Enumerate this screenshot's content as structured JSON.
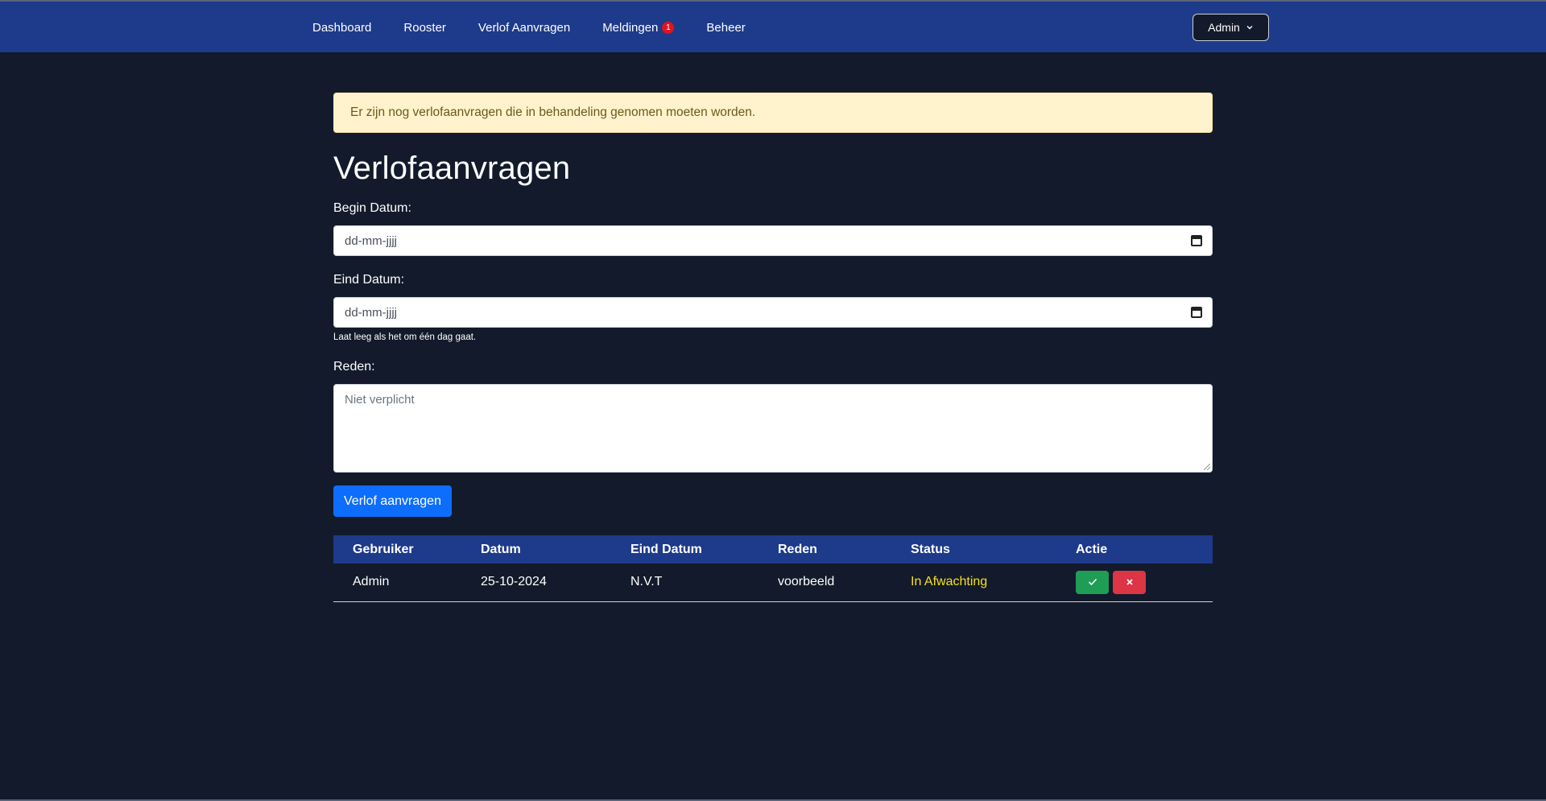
{
  "nav": {
    "links": [
      {
        "label": "Dashboard"
      },
      {
        "label": "Rooster"
      },
      {
        "label": "Verlof Aanvragen"
      },
      {
        "label": "Meldingen",
        "badge": "1"
      },
      {
        "label": "Beheer"
      }
    ],
    "user_menu_label": "Admin"
  },
  "alert": {
    "text": "Er zijn nog verlofaanvragen die in behandeling genomen moeten worden.",
    "color": "#fff3cd"
  },
  "page": {
    "title": "Verlofaanvragen"
  },
  "form": {
    "begin_label": "Begin Datum:",
    "begin_placeholder": "dd-mm-jjjj",
    "end_label": "Eind Datum:",
    "end_placeholder": "dd-mm-jjjj",
    "end_help": "Laat leeg als het om één dag gaat.",
    "reason_label": "Reden:",
    "reason_placeholder": "Niet verplicht",
    "submit_label": "Verlof aanvragen"
  },
  "table": {
    "headers": [
      "Gebruiker",
      "Datum",
      "Eind Datum",
      "Reden",
      "Status",
      "Actie"
    ],
    "rows": [
      {
        "user": "Admin",
        "date": "25-10-2024",
        "end_date": "N.V.T",
        "reason": "voorbeeld",
        "status": "In Afwachting",
        "approve_icon": "check-icon",
        "reject_icon": "x-icon"
      }
    ]
  },
  "colors": {
    "navbar": "#1e3a8a",
    "background": "#121a2b",
    "primary": "#0d6efd",
    "approve": "#1f9d55",
    "reject": "#dc3545",
    "pending": "#f7e01a"
  }
}
